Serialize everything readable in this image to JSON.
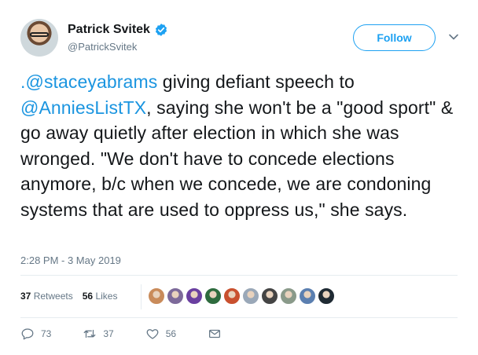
{
  "author": {
    "name": "Patrick Svitek",
    "handle": "@PatrickSvitek",
    "verified_icon": "verified-badge-icon"
  },
  "follow_label": "Follow",
  "tweet": {
    "mention1": ".@staceyabrams",
    "text1": " giving defiant speech to ",
    "mention2": "@AnniesListTX",
    "text2": ", saying she won't be a \"good sport\" & go away quietly after election in which she was wronged. \"We don't have to concede elections anymore, b/c when we concede, we are condoning systems that are used to oppress us,\" she says."
  },
  "timestamp": "2:28 PM - 3 May 2019",
  "stats": {
    "retweets_count": "37",
    "retweets_label": "Retweets",
    "likes_count": "56",
    "likes_label": "Likes"
  },
  "liker_avatars": [
    "#c98b5a",
    "#7d6a9a",
    "#6a3fa0",
    "#2e6b3e",
    "#c9502e",
    "#9aa8b8",
    "#444444",
    "#8a9a8a",
    "#5b7fb0",
    "#1f2a33"
  ],
  "actions": {
    "reply_count": "73",
    "retweet_count": "37",
    "like_count": "56"
  },
  "colors": {
    "accent": "#1da1f2",
    "mention": "#1b95e0",
    "muted": "#657786"
  }
}
